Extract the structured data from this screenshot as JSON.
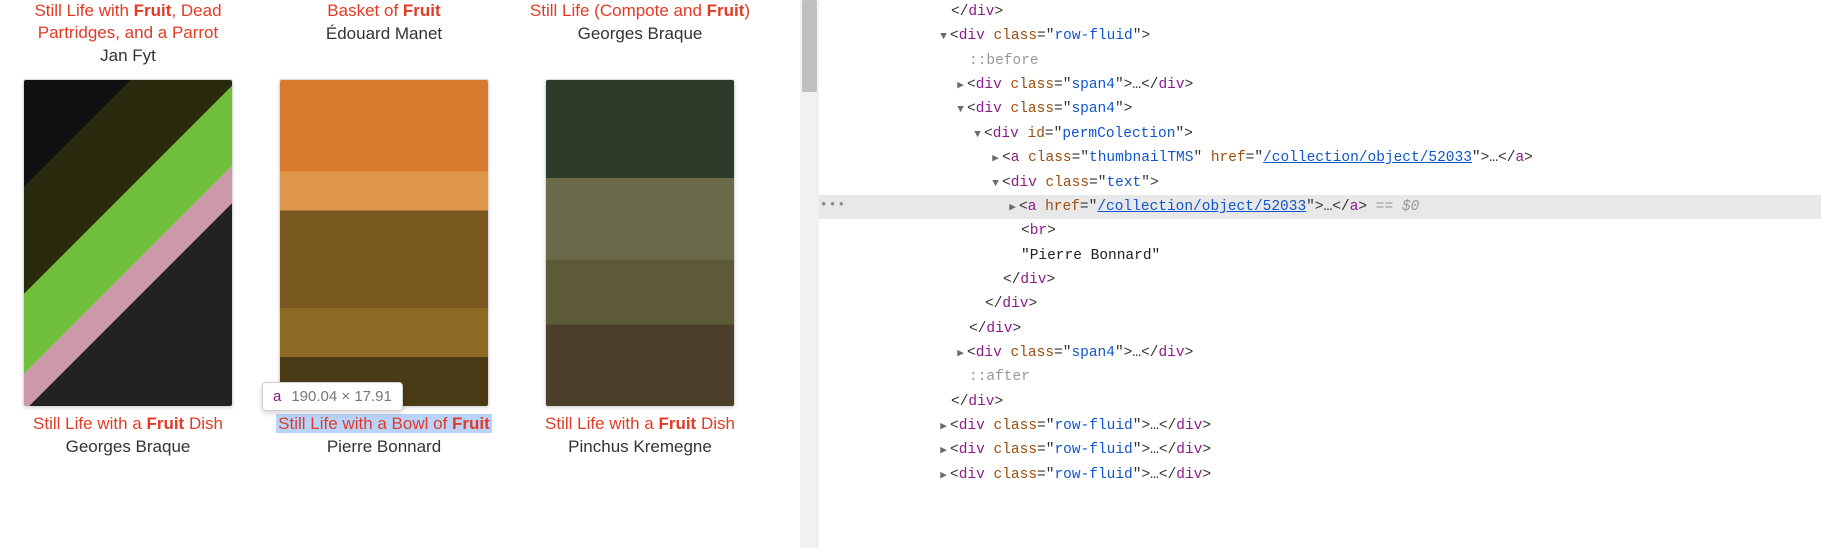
{
  "gallery": {
    "row1": [
      {
        "title_pre": "Still Life with ",
        "title_bold": "Fruit",
        "title_post": ", Dead Partridges, and a Parrot",
        "artist": "Jan Fyt"
      },
      {
        "title_pre": "Basket of ",
        "title_bold": "Fruit",
        "title_post": "",
        "artist": "Édouard Manet"
      },
      {
        "title_pre": "Still Life (Compote and ",
        "title_bold": "Fruit",
        "title_post": ")",
        "artist": "Georges Braque"
      }
    ],
    "row2": [
      {
        "title_pre": "Still Life with a ",
        "title_bold": "Fruit",
        "title_post": " Dish",
        "artist": "Georges Braque"
      },
      {
        "title_pre": "Still Life with a Bowl of ",
        "title_bold": "Fruit",
        "title_post": "",
        "artist": "Pierre Bonnard"
      },
      {
        "title_pre": "Still Life with a ",
        "title_bold": "Fruit",
        "title_post": " Dish",
        "artist": "Pinchus Kremegne"
      }
    ]
  },
  "tooltip": {
    "tag": "a",
    "dims": "190.04 × 17.91"
  },
  "devtools": {
    "selected_eq": " == $0",
    "href": "/collection/object/52033",
    "bonnard": "\"Pierre Bonnard\"",
    "row_fluid": "row-fluid",
    "span4": "span4",
    "permColl": "permColection",
    "thumbnailTMS": "thumbnailTMS",
    "textcls": "text",
    "before": "::before",
    "after": "::after",
    "ellipsis": "…",
    "br": "br",
    "div": "div",
    "a": "a",
    "class": "class",
    "id": "id",
    "hrefattr": "href"
  }
}
